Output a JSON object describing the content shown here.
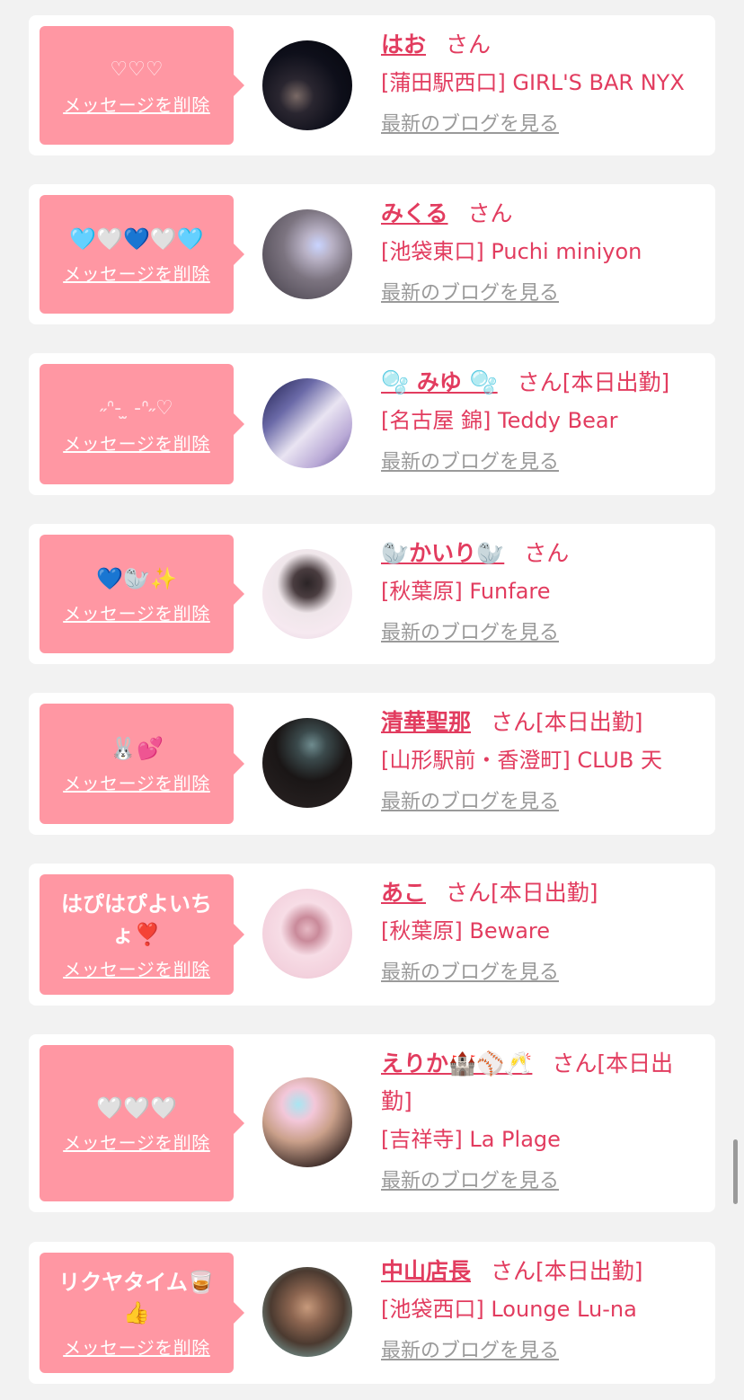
{
  "delete_label": "メッセージを削除",
  "san_label": "さん",
  "blog_label": "最新のブログを見る",
  "accent_color": "#e23c5f",
  "bubble_color": "#ff97a3",
  "entries": [
    {
      "message": "♡♡♡",
      "name": "はお",
      "status": "",
      "shop": "[蒲田駅西口] GIRL'S BAR NYX"
    },
    {
      "message": "🩵🤍💙🤍🩵",
      "name": "みくる",
      "status": "",
      "shop": "[池袋東口] Puchi miniyon"
    },
    {
      "message": "˶ᐢ- ̫ -ᐢ˶♡",
      "name": "🫧 みゆ 🫧",
      "status": "[本日出勤]",
      "shop": "[名古屋 錦] Teddy Bear"
    },
    {
      "message": "💙🦭✨",
      "name": "🦭かいり🦭",
      "status": "",
      "shop": "[秋葉原] Funfare"
    },
    {
      "message": "🐰💕",
      "name": "清華聖那",
      "status": "[本日出勤]",
      "shop": "[山形駅前・香澄町] CLUB 天"
    },
    {
      "message": "はぴはぴよいちょ❣️",
      "name": "あこ",
      "status": "[本日出勤]",
      "shop": "[秋葉原] Beware"
    },
    {
      "message": "🤍🤍🤍",
      "name": "えりか🏰⚾🥂",
      "status": "[本日出勤]",
      "shop": "[吉祥寺] La Plage"
    },
    {
      "message": "リクヤタイム🥃👍",
      "name": "中山店長",
      "status": "[本日出勤]",
      "shop": "[池袋西口] Lounge Lu-na"
    }
  ]
}
